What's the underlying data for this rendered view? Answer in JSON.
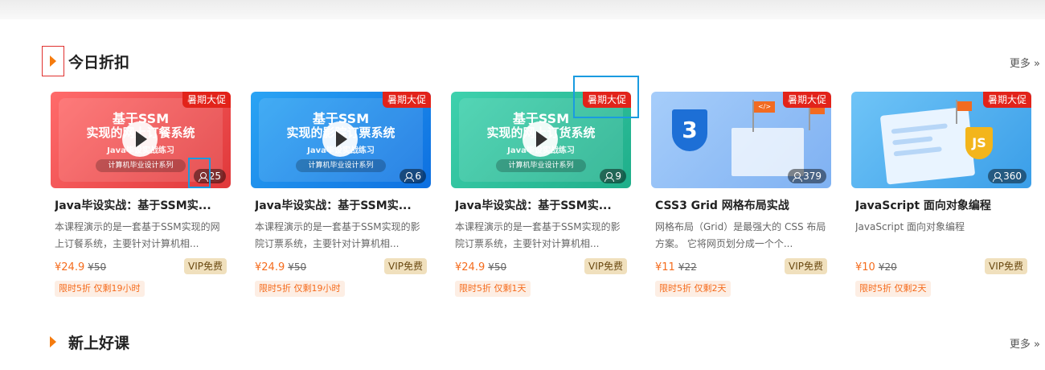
{
  "sections": [
    {
      "title": "今日折扣",
      "more": "更多 »"
    },
    {
      "title": "新上好课",
      "more": "更多 »"
    }
  ],
  "cards": [
    {
      "thumb_lines": [
        "基于SSM",
        "实现的网上订餐系统",
        "Java毕设实战练习",
        "计算机毕业设计系列"
      ],
      "promo": "暑期大促",
      "students": "25",
      "title": "Java毕设实战：基于SSM实...",
      "desc": "本课程演示的是一套基于SSM实现的网上订餐系统，主要针对计算机相...",
      "price": "¥24.9",
      "old_price": "¥50",
      "vip": "VIP免费",
      "limit": "限时5折  仅剩19小时"
    },
    {
      "thumb_lines": [
        "基于SSM",
        "实现的影院订票系统",
        "Java毕设实战练习",
        "计算机毕业设计系列"
      ],
      "promo": "暑期大促",
      "students": "6",
      "title": "Java毕设实战：基于SSM实...",
      "desc": "本课程演示的是一套基于SSM实现的影院订票系统，主要针对计算机相...",
      "price": "¥24.9",
      "old_price": "¥50",
      "vip": "VIP免费",
      "limit": "限时5折  仅剩19小时"
    },
    {
      "thumb_lines": [
        "基于SSM",
        "实现的网上订货系统",
        "Java毕设实战练习",
        "计算机毕业设计系列"
      ],
      "promo": "暑期大促",
      "students": "9",
      "title": "Java毕设实战：基于SSM实...",
      "desc": "本课程演示的是一套基于SSM实现的影院订票系统，主要针对计算机相...",
      "price": "¥24.9",
      "old_price": "¥50",
      "vip": "VIP免费",
      "limit": "限时5折  仅剩1天"
    },
    {
      "promo": "暑期大促",
      "students": "379",
      "logo": "3",
      "flag_text": "</>",
      "title": "CSS3 Grid 网格布局实战",
      "desc": "网格布局（Grid）是最强大的 CSS 布局方案。 它将网页划分成一个个...",
      "price": "¥11",
      "old_price": "¥22",
      "vip": "VIP免费",
      "limit": "限时5折  仅剩2天"
    },
    {
      "promo": "暑期大促",
      "students": "360",
      "logo": "JS",
      "title": "JavaScript 面向对象编程",
      "desc": "JavaScript 面向对象编程",
      "price": "¥10",
      "old_price": "¥20",
      "vip": "VIP免费",
      "limit": "限时5折  仅剩2天"
    }
  ],
  "icons": {
    "section_arrow": "triangle-right-icon",
    "play": "play-icon",
    "students": "user-icon"
  },
  "colors": {
    "accent": "#f57b0e",
    "promo": "#e2231a",
    "price": "#f56c1d",
    "vip_bg": "#f0e0bd"
  }
}
